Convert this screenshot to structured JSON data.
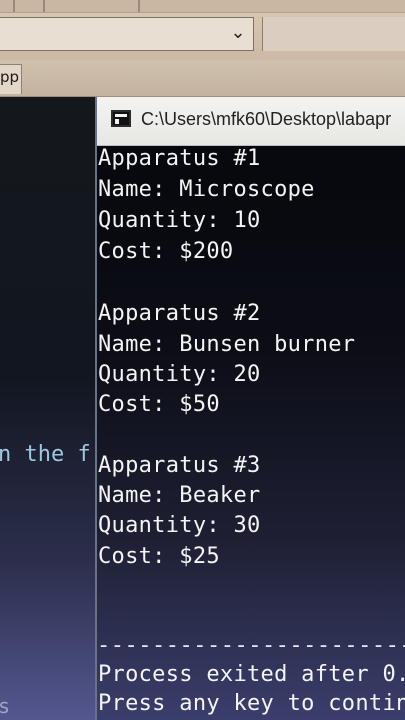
{
  "ide": {
    "tab_label": "pp",
    "combo_arrow": "chevron-down-icon",
    "code_fragment": "n the f",
    "bottom_fragment": "s"
  },
  "console": {
    "title": "C:\\Users\\mfk60\\Desktop\\labapr",
    "icon": "console-icon",
    "apparatus": [
      {
        "header": "Apparatus #1",
        "name": "Name: Microscope",
        "quantity": "Quantity: 10",
        "cost": "Cost: $200"
      },
      {
        "header": "Apparatus #2",
        "name": "Name: Bunsen burner",
        "quantity": "Quantity: 20",
        "cost": "Cost: $50"
      },
      {
        "header": "Apparatus #3",
        "name": "Name: Beaker",
        "quantity": "Quantity: 30",
        "cost": "Cost: $25"
      }
    ],
    "separator": "--------------------------------",
    "process_exit": "Process exited after 0.",
    "press_key": "Press any key to contin"
  }
}
